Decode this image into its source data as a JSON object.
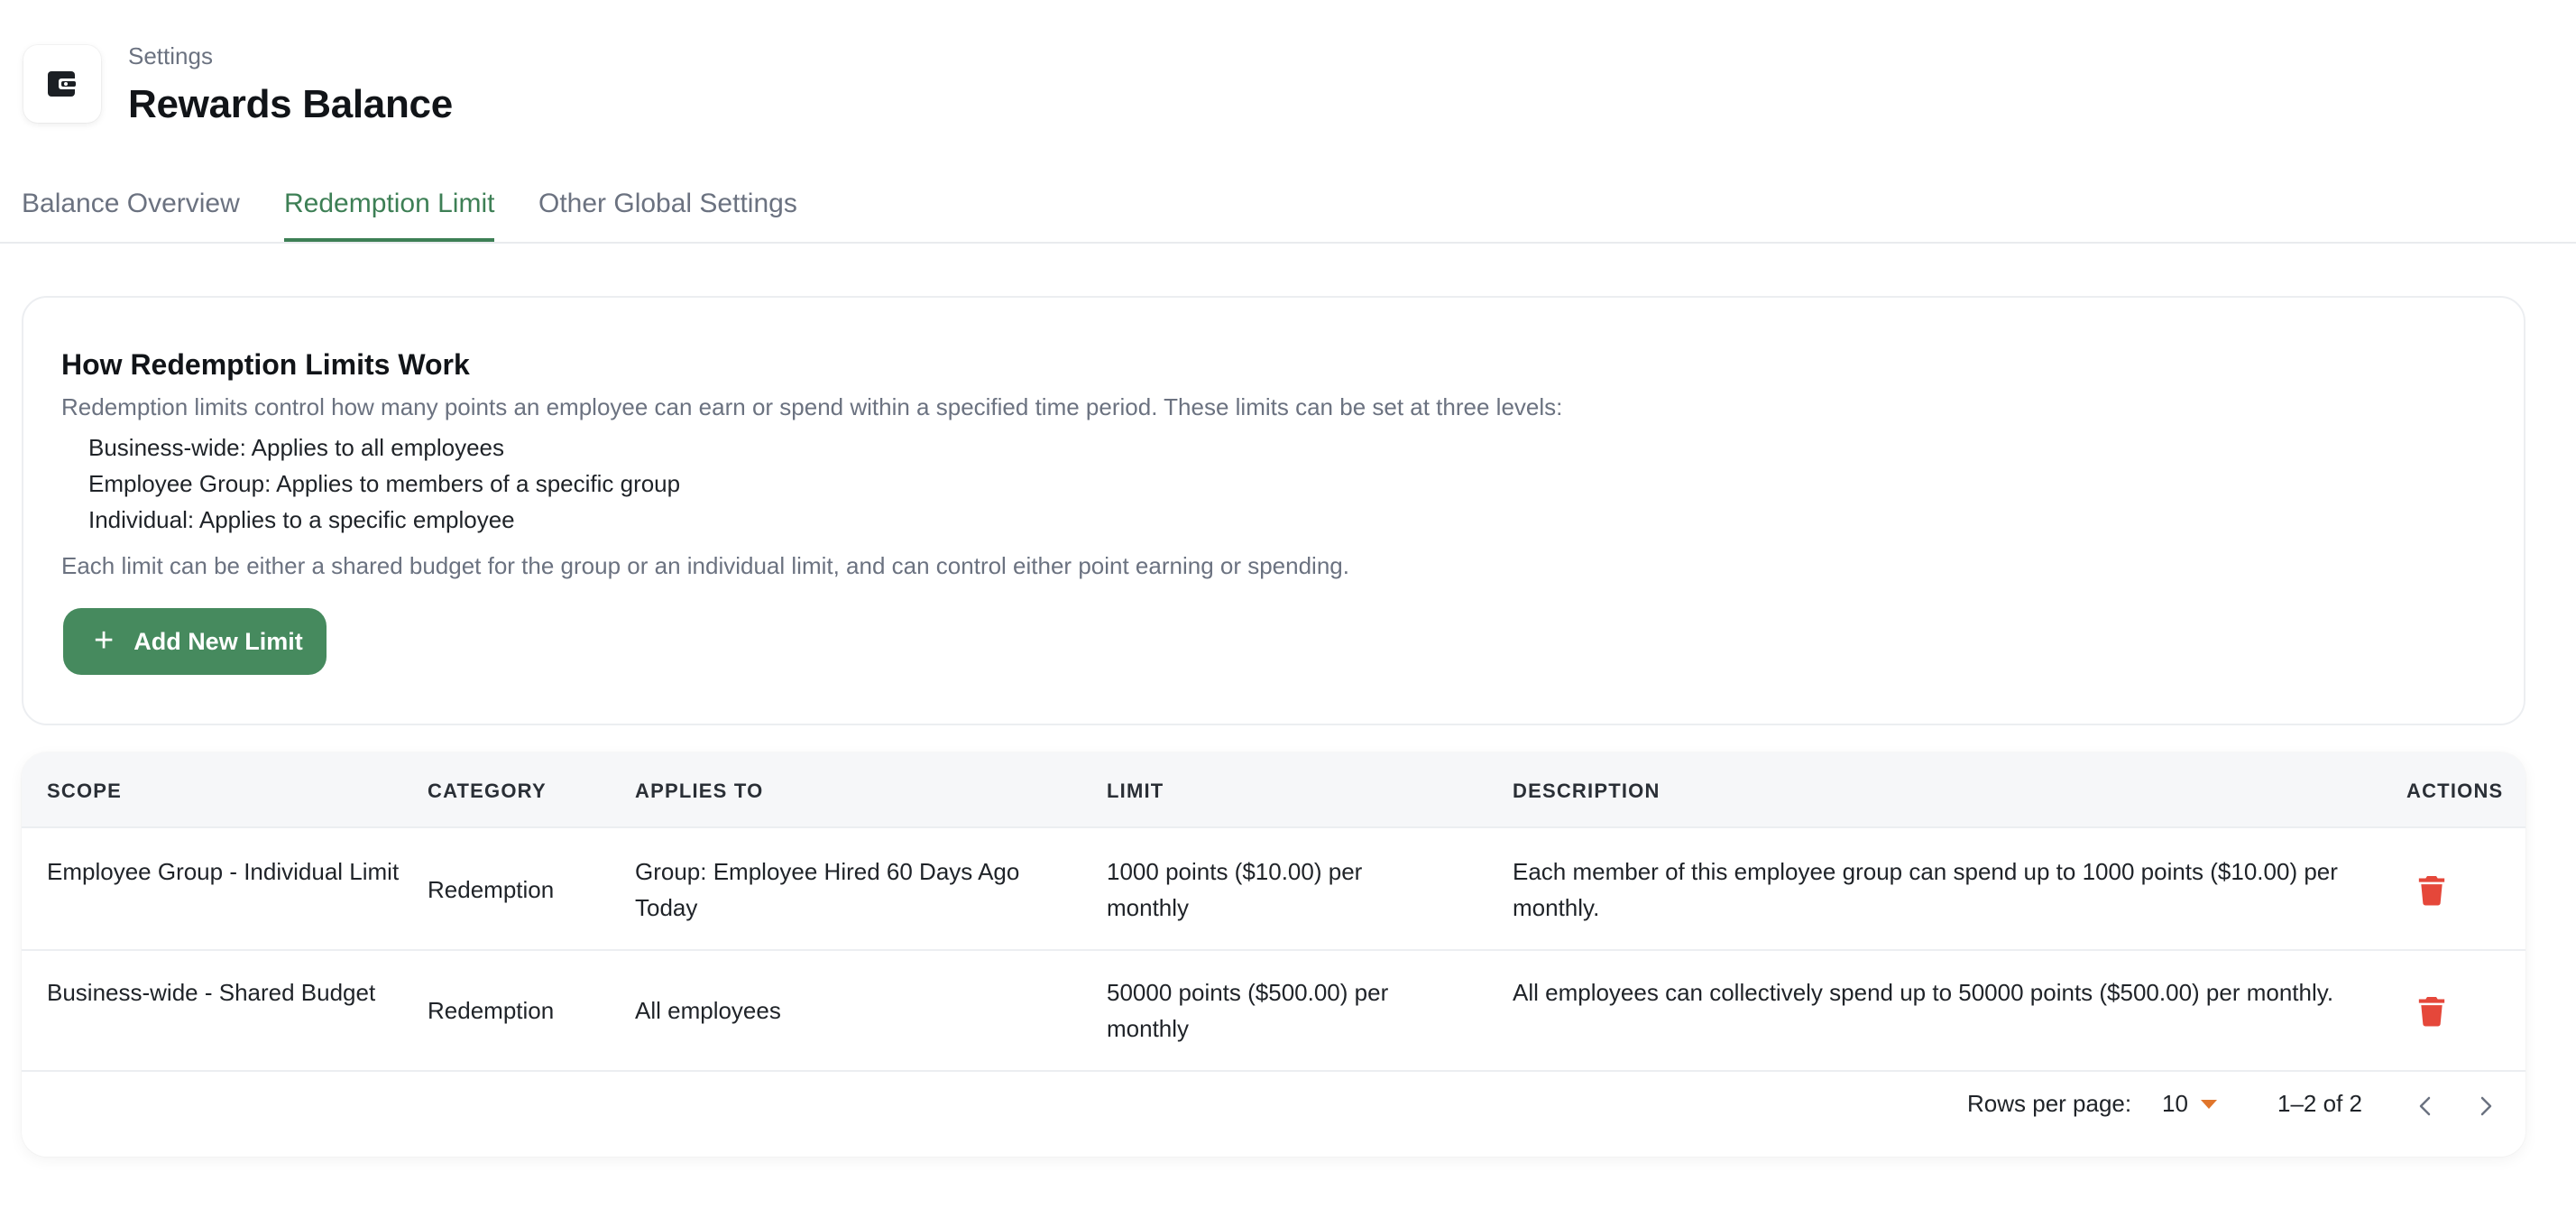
{
  "header": {
    "breadcrumb": "Settings",
    "title": "Rewards Balance",
    "icon": "wallet-icon"
  },
  "tabs": [
    {
      "label": "Balance Overview",
      "active": false
    },
    {
      "label": "Redemption Limit",
      "active": true
    },
    {
      "label": "Other Global Settings",
      "active": false
    }
  ],
  "info": {
    "title": "How Redemption Limits Work",
    "description": "Redemption limits control how many points an employee can earn or spend within a specified time period. These limits can be set at three levels:",
    "levels": [
      "Business-wide: Applies to all employees",
      "Employee Group: Applies to members of a specific group",
      "Individual: Applies to a specific employee"
    ],
    "footer": "Each limit can be either a shared budget for the group or an individual limit, and can control either point earning or spending.",
    "add_button": "Add New Limit"
  },
  "table": {
    "columns": [
      "SCOPE",
      "CATEGORY",
      "APPLIES TO",
      "LIMIT",
      "DESCRIPTION",
      "ACTIONS"
    ],
    "rows": [
      {
        "scope": "Employee Group - Individual Limit",
        "category": "Redemption",
        "applies_to": "Group: Employee Hired 60 Days Ago Today",
        "limit": "1000 points ($10.00) per monthly",
        "description": "Each member of this employee group can spend up to 1000 points ($10.00) per monthly."
      },
      {
        "scope": "Business-wide - Shared Budget",
        "category": "Redemption",
        "applies_to": "All employees",
        "limit": "50000 points ($500.00) per monthly",
        "description": "All employees can collectively spend up to 50000 points ($500.00) per monthly."
      }
    ]
  },
  "pagination": {
    "rows_per_page_label": "Rows per page:",
    "rows_per_page": "10",
    "range": "1–2 of 2"
  },
  "colors": {
    "accent": "#3d7f55",
    "button": "#468a5e",
    "danger": "#e5473a",
    "dropdown_arrow": "#e0752b"
  }
}
